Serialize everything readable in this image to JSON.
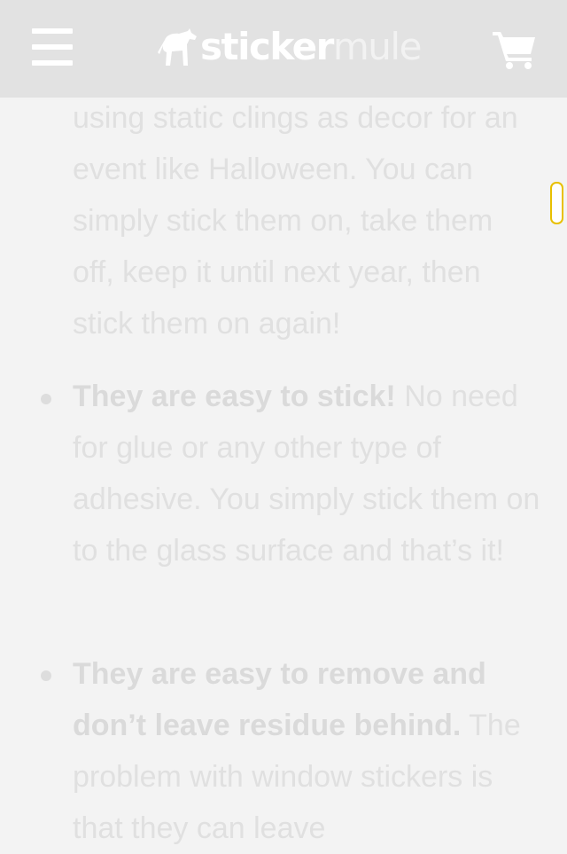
{
  "header": {
    "logo_part1": "sticker",
    "logo_part2": "mule",
    "menu_icon": "hamburger-menu-icon",
    "cart_icon": "shopping-cart-icon",
    "background": "#e2e2e2"
  },
  "article": {
    "intro_text": "using static clings as decor for an event like Halloween. You can simply stick them on, take them off, keep it until next year, then stick them on again!",
    "items": [
      {
        "bold": "They are easy to stick!",
        "text": " No need for glue or any other type of adhesive. You simply stick them on to the glass surface and that’s it!"
      },
      {
        "bold": "They are easy to remove and don’t leave residue behind.",
        "text": " The problem with window stickers is that they can leave"
      }
    ]
  },
  "colors": {
    "text": "#e0e0e0",
    "scroll_handle_border": "#e8c000"
  }
}
